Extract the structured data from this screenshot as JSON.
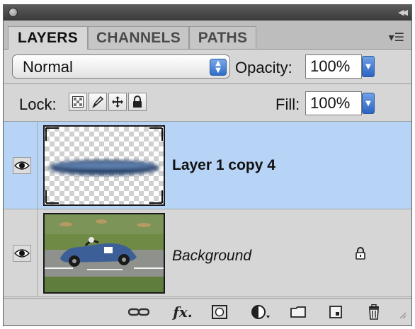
{
  "tabs": [
    {
      "label": "LAYERS",
      "active": true
    },
    {
      "label": "CHANNELS",
      "active": false
    },
    {
      "label": "PATHS",
      "active": false
    }
  ],
  "blend_mode": {
    "value": "Normal",
    "options": [
      "Normal"
    ]
  },
  "opacity": {
    "label": "Opacity:",
    "value": "100%"
  },
  "lock": {
    "label": "Lock:",
    "icons": [
      "lock-transparent-pixels-icon",
      "lock-image-pixels-icon",
      "lock-position-icon",
      "lock-all-icon"
    ]
  },
  "fill": {
    "label": "Fill:",
    "value": "100%"
  },
  "layers": [
    {
      "name": "Layer 1 copy 4",
      "selected": true,
      "visible": true,
      "italic": false,
      "bold": true,
      "locked": false,
      "thumbnail": "transparent-blurred-car-shadow"
    },
    {
      "name": "Background",
      "selected": false,
      "visible": true,
      "italic": true,
      "bold": false,
      "locked": true,
      "thumbnail": "blue-race-car-photo"
    }
  ],
  "footer_icons": [
    "link-layers-icon",
    "layer-style-fx-icon",
    "layer-mask-icon",
    "adjustment-layer-icon",
    "group-folder-icon",
    "new-layer-icon",
    "trash-icon"
  ],
  "colors": {
    "selection": "#b7d3f5",
    "accent_blue": "#2e6dc9",
    "panel_bg": "#d6d6d6"
  }
}
